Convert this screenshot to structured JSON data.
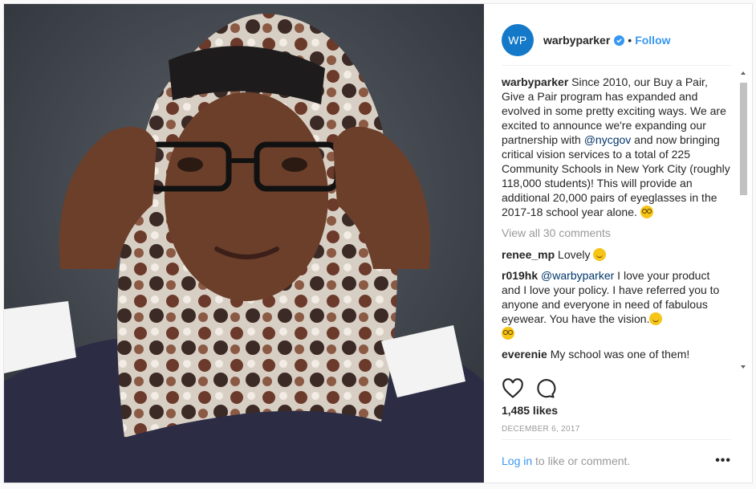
{
  "header": {
    "avatar_text": "WP",
    "username": "warbyparker",
    "separator": "•",
    "follow_label": "Follow",
    "verified_icon": "verified-badge-icon"
  },
  "caption": {
    "username": "warbyparker",
    "text_1": " Since 2010, our Buy a Pair, Give a Pair program has expanded and evolved in some pretty exciting ways. We are excited to announce we're expanding our partnership with ",
    "mention": "@nycgov",
    "text_2": " and now bringing critical vision services to a total of 225 Community Schools in New York City (roughly 118,000 students)! This will provide an additional 20,000 pairs of eyeglasses in the 2017-18 school year alone. ",
    "emoji": "nerd-face-emoji"
  },
  "view_all": "View all 30 comments",
  "comments": [
    {
      "user": "renee_mp",
      "text": " Lovely ",
      "emoji": "smiling-face-emoji"
    },
    {
      "user": "r019hk",
      "mention": "@warbyparker",
      "text": " I love your product and I love your policy. I have referred you to anyone and everyone in need of fabulous eyewear. You have the vision.",
      "emoji": "winking-face-emoji",
      "emoji2": "nerd-face-emoji"
    },
    {
      "user": "everenie",
      "text": " My school was one of them!"
    }
  ],
  "likes": "1,485 likes",
  "date": "DECEMBER 6, 2017",
  "footer": {
    "login_label": "Log in",
    "rest": " to like or comment.",
    "more_label": "•••"
  },
  "colors": {
    "accent": "#3897f0",
    "avatar_bg": "#1479c9"
  }
}
